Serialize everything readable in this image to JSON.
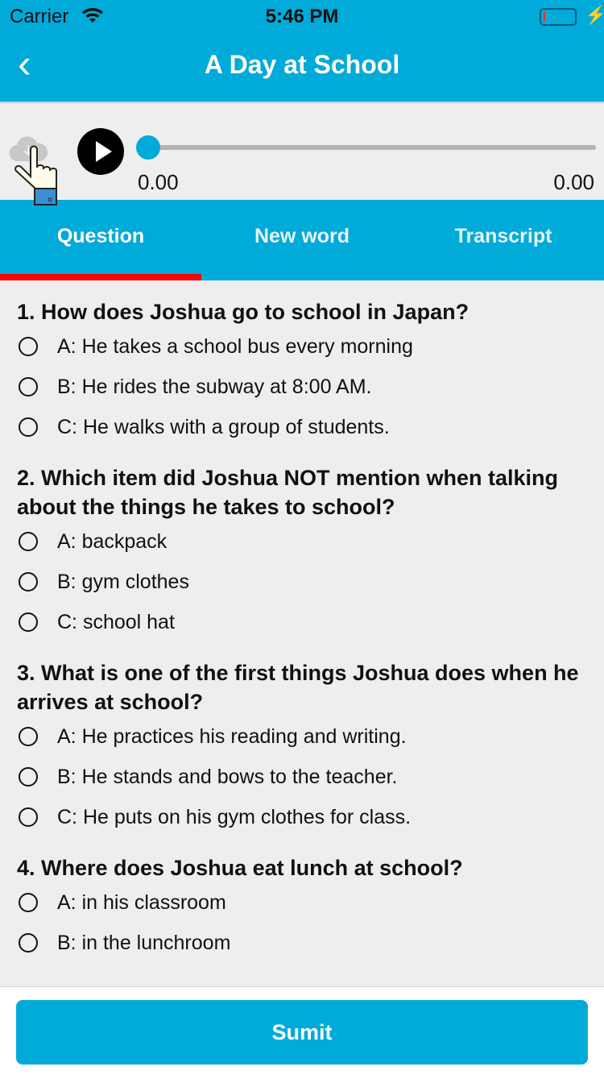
{
  "status_bar": {
    "carrier": "Carrier",
    "time": "5:46 PM"
  },
  "nav": {
    "title": "A Day at School"
  },
  "player": {
    "current_time": "0.00",
    "total_time": "0.00",
    "progress": 0
  },
  "tabs": [
    {
      "label": "Question",
      "active": true
    },
    {
      "label": "New word",
      "active": false
    },
    {
      "label": "Transcript",
      "active": false
    }
  ],
  "questions": [
    {
      "text": "1. How does Joshua go to school in Japan?",
      "options": [
        "A: He takes a school bus every morning",
        "B: He rides the subway at 8:00 AM.",
        "C: He walks with a group of students."
      ]
    },
    {
      "text": "2. Which item did Joshua NOT mention when talking about the things he takes to school?",
      "options": [
        "A: backpack",
        "B: gym clothes",
        "C: school hat"
      ]
    },
    {
      "text": "3. What is one of the first things Joshua does when he arrives at school?",
      "options": [
        "A: He practices his reading and writing.",
        "B: He stands and bows to the teacher.",
        "C: He puts on his gym clothes for class."
      ]
    },
    {
      "text": "4. Where does Joshua eat lunch at school?",
      "options": [
        "A: in his classroom",
        "B: in the lunchroom"
      ]
    }
  ],
  "submit_label": "Sumit",
  "colors": {
    "primary": "#00aad9",
    "tab_indicator": "#ff0000"
  }
}
